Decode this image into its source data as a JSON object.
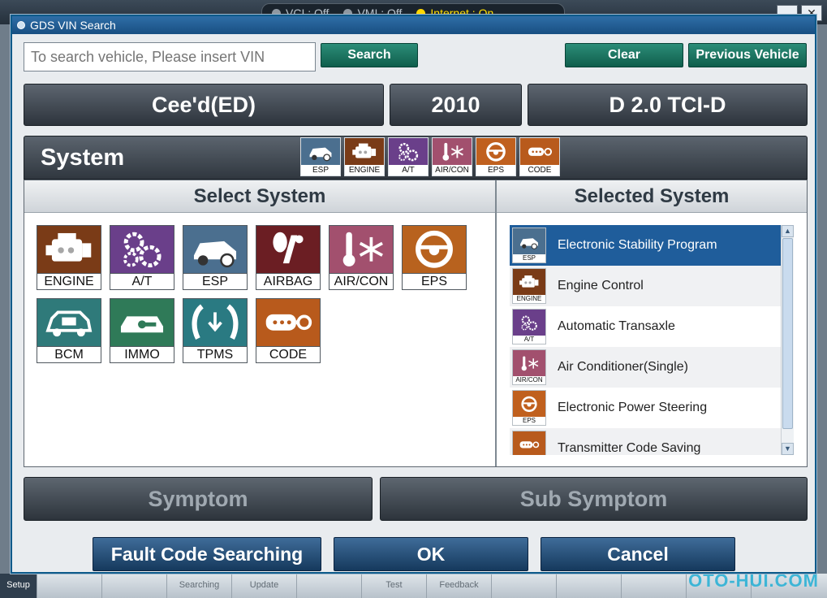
{
  "bg_status": {
    "vci": "VCI : Off",
    "vmi": "VMI : Off",
    "internet": "Internet : On"
  },
  "window_controls": {
    "minimize": "—",
    "close": "✕"
  },
  "bottom_bar": {
    "cells": [
      "Setup",
      "",
      "",
      "Searching",
      "Update",
      "",
      "Test",
      "Feedback",
      "",
      "",
      "",
      ""
    ]
  },
  "watermark": "OTO-HUI.COM",
  "dialog": {
    "title": "GDS VIN Search",
    "vin_placeholder": "To search vehicle, Please insert VIN",
    "search_label": "Search",
    "clear_label": "Clear",
    "previous_label": "Previous Vehicle",
    "model": "Cee'd(ED)",
    "year": "2010",
    "engine": "D 2.0 TCI-D"
  },
  "system": {
    "title": "System",
    "mini_icons": [
      {
        "label": "ESP",
        "color": "#4b6f8f"
      },
      {
        "label": "ENGINE",
        "color": "#7a3b17"
      },
      {
        "label": "A/T",
        "color": "#6a3f8a"
      },
      {
        "label": "AIR/CON",
        "color": "#a2506e"
      },
      {
        "label": "EPS",
        "color": "#c0601e"
      },
      {
        "label": "CODE",
        "color": "#b85a1c"
      }
    ]
  },
  "select_system": {
    "title": "Select System",
    "tiles": [
      {
        "label": "ENGINE",
        "color": "#7a3b17"
      },
      {
        "label": "A/T",
        "color": "#6a3f8a"
      },
      {
        "label": "ESP",
        "color": "#4b6f8f"
      },
      {
        "label": "AIRBAG",
        "color": "#6b1e23"
      },
      {
        "label": "AIR/CON",
        "color": "#a2506e"
      },
      {
        "label": "EPS",
        "color": "#b8621e"
      },
      {
        "label": "BCM",
        "color": "#2f7a7a"
      },
      {
        "label": "IMMO",
        "color": "#2f7a58"
      },
      {
        "label": "TPMS",
        "color": "#2a7a82"
      },
      {
        "label": "CODE",
        "color": "#b85a1c"
      }
    ]
  },
  "selected_system": {
    "title": "Selected System",
    "items": [
      {
        "icon": "ESP",
        "label": "Electronic Stability Program",
        "color": "#4b6f8f"
      },
      {
        "icon": "ENGINE",
        "label": "Engine Control",
        "color": "#7a3b17"
      },
      {
        "icon": "A/T",
        "label": "Automatic Transaxle",
        "color": "#6a3f8a"
      },
      {
        "icon": "AIR/CON",
        "label": "Air Conditioner(Single)",
        "color": "#a2506e"
      },
      {
        "icon": "EPS",
        "label": "Electronic Power Steering",
        "color": "#c0601e"
      },
      {
        "icon": "",
        "label": "Transmitter Code Saving",
        "color": "#b85a1c"
      }
    ]
  },
  "symptom_label": "Symptom",
  "sub_symptom_label": "Sub Symptom",
  "buttons": {
    "fault_code": "Fault Code Searching",
    "ok": "OK",
    "cancel": "Cancel"
  }
}
